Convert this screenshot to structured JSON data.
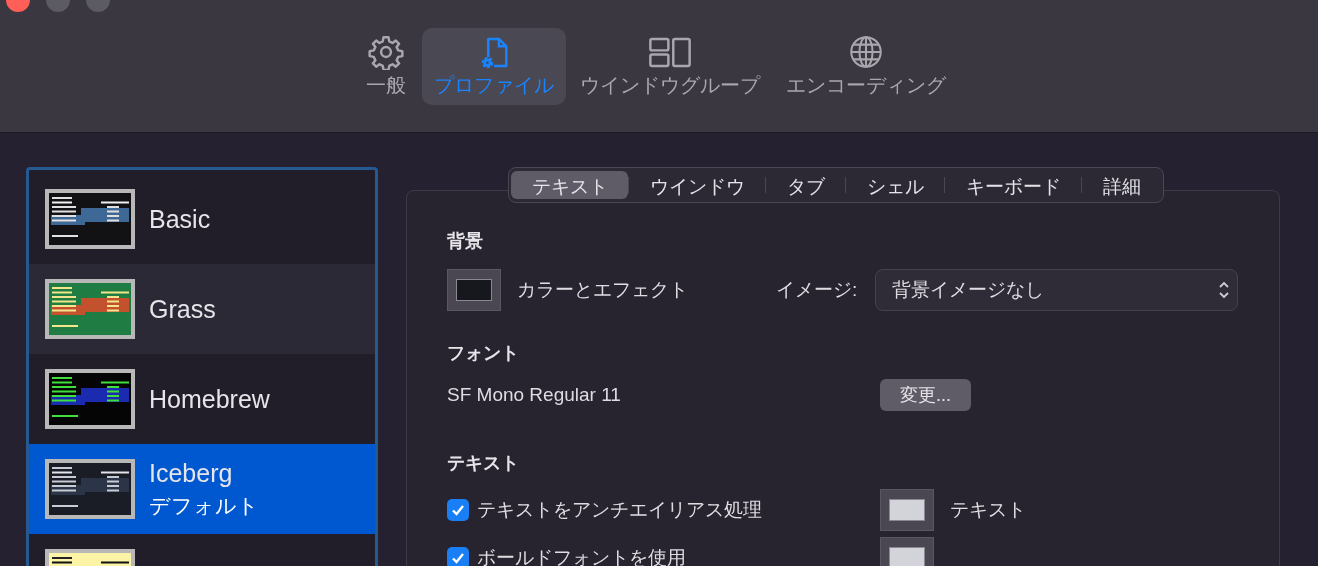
{
  "toolbar": [
    {
      "label": "一般",
      "kind": "gear",
      "selected": false
    },
    {
      "label": "プロファイル",
      "kind": "profile",
      "selected": true
    },
    {
      "label": "ウインドウグループ",
      "kind": "windows",
      "selected": false
    },
    {
      "label": "エンコーディング",
      "kind": "globe",
      "selected": false
    }
  ],
  "profiles": [
    {
      "name": "Basic",
      "kind": "basic",
      "selected": false
    },
    {
      "name": "Grass",
      "kind": "grass",
      "selected": false
    },
    {
      "name": "Homebrew",
      "kind": "homebrew",
      "selected": false
    },
    {
      "name": "Iceberg",
      "subtitle": "デフォルト",
      "kind": "iceberg",
      "selected": true
    },
    {
      "kind": "yellow",
      "selected": false
    }
  ],
  "tabs": [
    {
      "label": "テキスト",
      "selected": true
    },
    {
      "label": "ウインドウ",
      "selected": false
    },
    {
      "label": "タブ",
      "selected": false
    },
    {
      "label": "シェル",
      "selected": false
    },
    {
      "label": "キーボード",
      "selected": false
    },
    {
      "label": "詳細",
      "selected": false
    }
  ],
  "background": {
    "heading": "背景",
    "color": "#16181d",
    "color_label": "カラーとエフェクト",
    "image_label": "イメージ:",
    "image_value": "背景イメージなし"
  },
  "font": {
    "heading": "フォント",
    "name": "SF Mono Regular 11",
    "button": "変更..."
  },
  "text": {
    "heading": "テキスト",
    "options": [
      {
        "label": "テキストをアンチエイリアス処理",
        "checked": true
      },
      {
        "label": "ボールドフォントを使用",
        "checked": true
      }
    ],
    "colors": [
      {
        "label": "テキスト",
        "color": "#d3d4da"
      },
      {
        "color": "#d3d4da"
      }
    ]
  }
}
